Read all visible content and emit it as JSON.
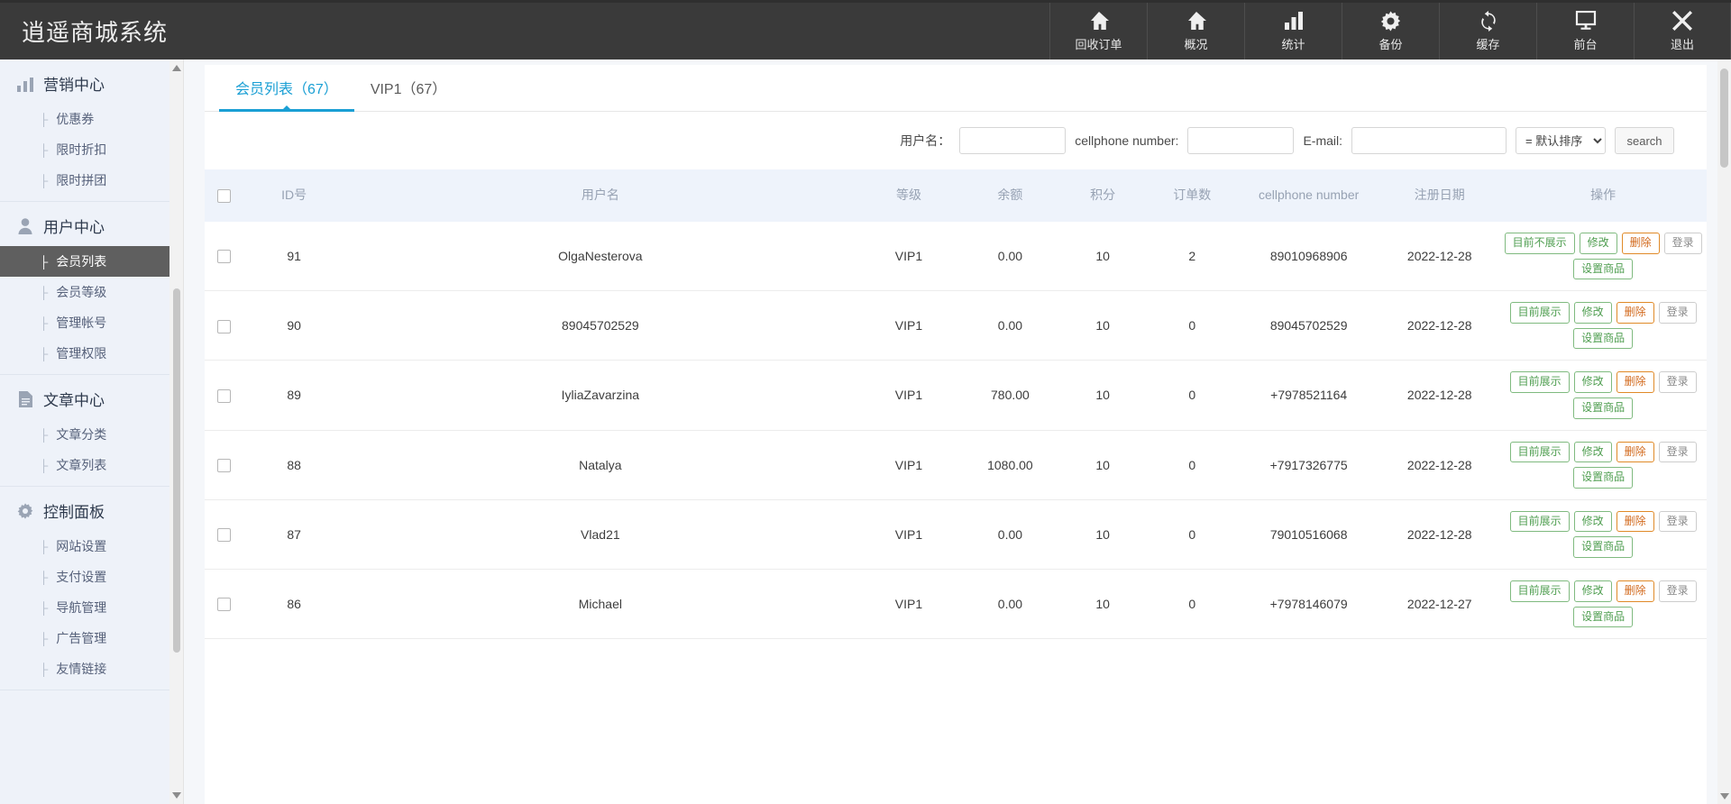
{
  "app": {
    "title": "逍遥商城系统"
  },
  "topnav": [
    {
      "label": "回收订单",
      "icon": "home-icon"
    },
    {
      "label": "概况",
      "icon": "home-icon"
    },
    {
      "label": "统计",
      "icon": "bar-chart-icon"
    },
    {
      "label": "备份",
      "icon": "gear-icon"
    },
    {
      "label": "缓存",
      "icon": "refresh-icon"
    },
    {
      "label": "前台",
      "icon": "monitor-icon"
    },
    {
      "label": "退出",
      "icon": "close-icon"
    }
  ],
  "sidebar": {
    "groups": [
      {
        "title": "营销中心",
        "icon": "chart-icon",
        "items": [
          {
            "label": "优惠券",
            "active": false
          },
          {
            "label": "限时折扣",
            "active": false
          },
          {
            "label": "限时拼团",
            "active": false
          }
        ]
      },
      {
        "title": "用户中心",
        "icon": "user-icon",
        "items": [
          {
            "label": "会员列表",
            "active": true
          },
          {
            "label": "会员等级",
            "active": false
          },
          {
            "label": "管理帐号",
            "active": false
          },
          {
            "label": "管理权限",
            "active": false
          }
        ]
      },
      {
        "title": "文章中心",
        "icon": "document-icon",
        "items": [
          {
            "label": "文章分类",
            "active": false
          },
          {
            "label": "文章列表",
            "active": false
          }
        ]
      },
      {
        "title": "控制面板",
        "icon": "gear-icon",
        "items": [
          {
            "label": "网站设置",
            "active": false
          },
          {
            "label": "支付设置",
            "active": false
          },
          {
            "label": "导航管理",
            "active": false
          },
          {
            "label": "广告管理",
            "active": false
          },
          {
            "label": "友情链接",
            "active": false
          }
        ]
      }
    ]
  },
  "tabs": [
    {
      "label": "会员列表（67）",
      "active": true
    },
    {
      "label": "VIP1（67）",
      "active": false
    }
  ],
  "search": {
    "username_label": "用户名：",
    "username_value": "",
    "cellphone_label": "cellphone number:",
    "cellphone_value": "",
    "email_label": "E-mail:",
    "email_value": "",
    "sort_selected": "= 默认排序 =",
    "sort_options": [
      "= 默认排序 ="
    ],
    "search_button": "search"
  },
  "table": {
    "headers": {
      "id": "ID号",
      "username": "用户名",
      "level": "等级",
      "balance": "余额",
      "points": "积分",
      "orders": "订单数",
      "cellphone": "cellphone number",
      "regdate": "注册日期",
      "actions": "操作"
    },
    "action_labels": {
      "show_state_hidden": "目前不展示",
      "show_state_shown": "目前展示",
      "edit": "修改",
      "delete": "删除",
      "login": "登录",
      "set_goods": "设置商品"
    },
    "rows": [
      {
        "id": "91",
        "username": "OlgaNesterova",
        "level": "VIP1",
        "balance": "0.00",
        "points": "10",
        "orders": "2",
        "cellphone": "89010968906",
        "regdate": "2022-12-28",
        "show_state": "目前不展示"
      },
      {
        "id": "90",
        "username": "89045702529",
        "level": "VIP1",
        "balance": "0.00",
        "points": "10",
        "orders": "0",
        "cellphone": "89045702529",
        "regdate": "2022-12-28",
        "show_state": "目前展示"
      },
      {
        "id": "89",
        "username": "IyliaZavarzina",
        "level": "VIP1",
        "balance": "780.00",
        "points": "10",
        "orders": "0",
        "cellphone": "+7978521164",
        "regdate": "2022-12-28",
        "show_state": "目前展示"
      },
      {
        "id": "88",
        "username": "Natalya",
        "level": "VIP1",
        "balance": "1080.00",
        "points": "10",
        "orders": "0",
        "cellphone": "+7917326775",
        "regdate": "2022-12-28",
        "show_state": "目前展示"
      },
      {
        "id": "87",
        "username": "Vlad21",
        "level": "VIP1",
        "balance": "0.00",
        "points": "10",
        "orders": "0",
        "cellphone": "79010516068",
        "regdate": "2022-12-28",
        "show_state": "目前展示"
      },
      {
        "id": "86",
        "username": "Michael",
        "level": "VIP1",
        "balance": "0.00",
        "points": "10",
        "orders": "0",
        "cellphone": "+7978146079",
        "regdate": "2022-12-27",
        "show_state": "目前展示"
      }
    ]
  },
  "colors": {
    "accent": "#1a9fd4",
    "money": "#e8641c",
    "order_link": "#2f6fd0",
    "topbar": "#3a3a3a",
    "sidebar": "#eef2f9",
    "active_item": "#5f5f5f"
  }
}
